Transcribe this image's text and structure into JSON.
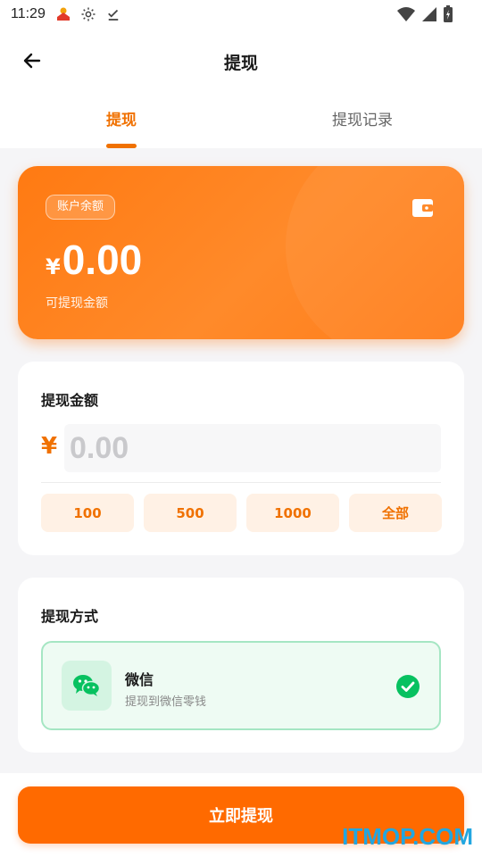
{
  "status_bar": {
    "time": "11:29",
    "icons": [
      "app-notification-icon",
      "gear-icon",
      "download-done-icon",
      "wifi-icon",
      "signal-icon",
      "battery-icon"
    ]
  },
  "header": {
    "title": "提现",
    "back_icon": "arrow-left-icon"
  },
  "tabs": [
    {
      "label": "提现",
      "active": true
    },
    {
      "label": "提现记录",
      "active": false
    }
  ],
  "balance_card": {
    "tag": "账户余额",
    "currency": "¥",
    "amount": "0.00",
    "label": "可提现金额",
    "icon": "wallet-icon"
  },
  "amount_section": {
    "title": "提现金额",
    "currency": "¥",
    "placeholder": "0.00",
    "quick_amounts": [
      "100",
      "500",
      "1000",
      "全部"
    ]
  },
  "method_section": {
    "title": "提现方式",
    "option": {
      "name": "微信",
      "description": "提现到微信零钱",
      "selected": true,
      "icon": "wechat-icon"
    }
  },
  "submit": {
    "label": "立即提现"
  },
  "watermark": "ITMOP.COM",
  "colors": {
    "accent": "#f07100",
    "button": "#ff6a00",
    "wechat_green": "#07c160"
  }
}
